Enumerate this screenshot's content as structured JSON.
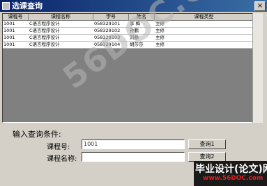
{
  "window": {
    "title": "选课查询",
    "close_label": "×"
  },
  "grid": {
    "columns": [
      "课程号",
      "课程名称",
      "学号",
      "姓名",
      "课程类型"
    ],
    "rows": [
      [
        "1001",
        "C语言程序设计",
        "058329101",
        "李 梅",
        "主修"
      ],
      [
        "1001",
        "C语言程序设计",
        "058329102",
        "孙鹏",
        "主修"
      ],
      [
        "1001",
        "C语言程序设计",
        "058329103",
        "刘静",
        "主修"
      ],
      [
        "1001",
        "C语言程序设计",
        "058329104",
        "胡莎莎",
        "主修"
      ]
    ]
  },
  "query": {
    "condition_label": "输入查询条件:",
    "course_no_label": "课程号:",
    "course_no_value": "1001",
    "course_name_label": "课程名称:",
    "course_name_value": "",
    "query_button_1": "查询1",
    "query_button_2": "查询2"
  },
  "watermark": {
    "text": "56DOC.COM"
  },
  "brand": {
    "line1": "毕业设计(论文)网",
    "line2": "www.56DOC.com"
  }
}
